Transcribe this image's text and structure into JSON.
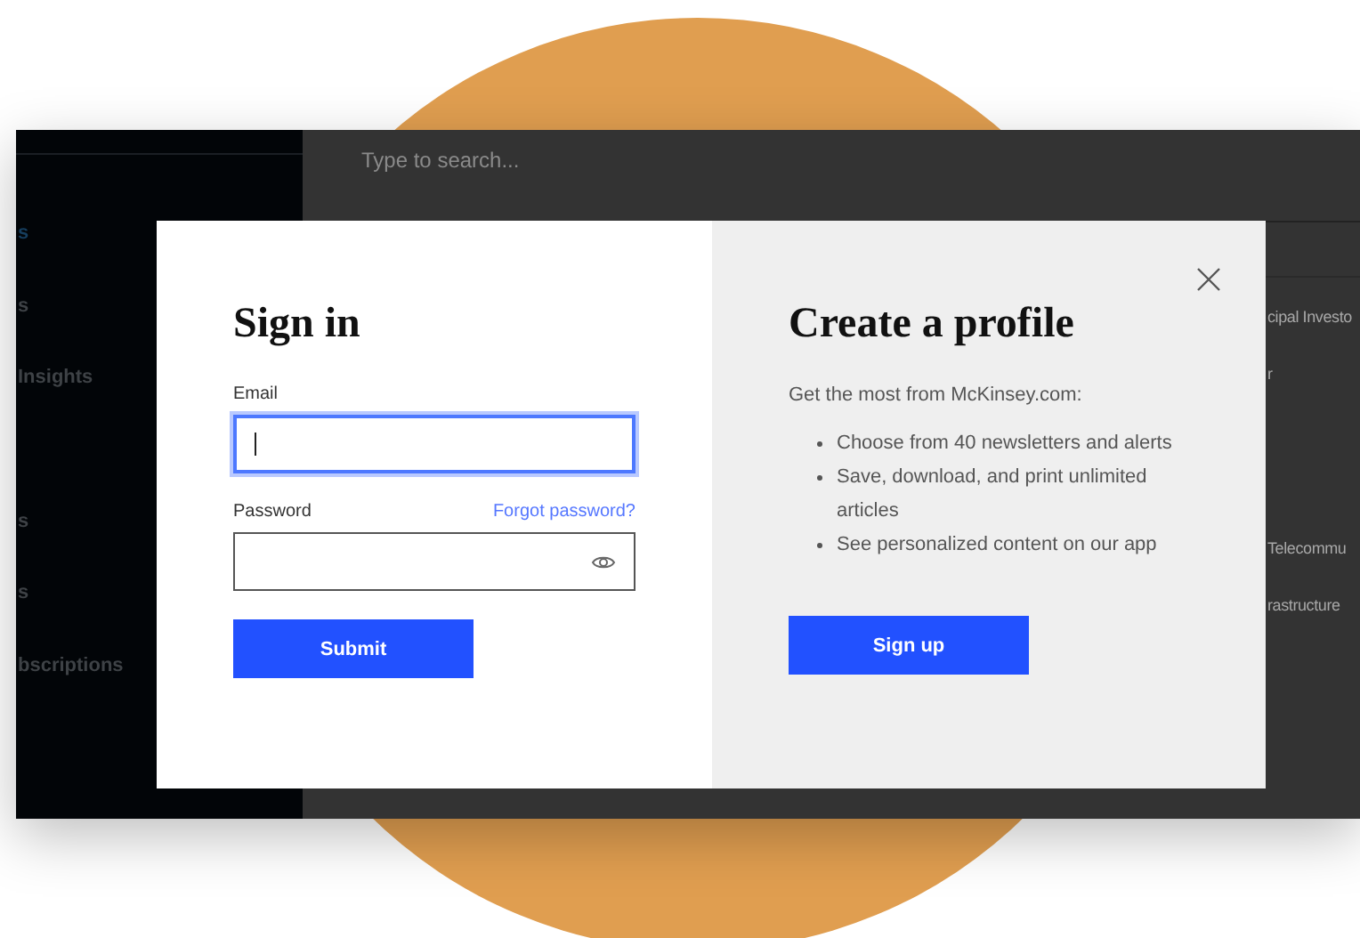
{
  "sidebar": {
    "items": [
      {
        "label": "s",
        "selected": true
      },
      {
        "label": "s",
        "selected": false
      },
      {
        "label": "Insights",
        "selected": false
      },
      {
        "label": "s",
        "selected": false
      },
      {
        "label": "s",
        "selected": false
      },
      {
        "label": "bscriptions",
        "selected": false
      }
    ]
  },
  "search": {
    "placeholder": "Type to search..."
  },
  "main": {
    "items": [
      "cipal Investo",
      "r",
      "Telecommu",
      "rastructure"
    ]
  },
  "dialog": {
    "sign_in": {
      "title": "Sign in",
      "email": {
        "label": "Email",
        "focused": true
      },
      "password": {
        "label": "Password",
        "focused": false
      },
      "forgot_link": "Forgot password?",
      "submit": "Submit"
    },
    "profile": {
      "title": "Create a profile",
      "intro": "Get the most from McKinsey.com:",
      "benefits": [
        "Choose from 40 newsletters and alerts",
        "Save, download, and print unlimited articles",
        "See personalized content on our app"
      ],
      "button": "Sign up"
    }
  }
}
